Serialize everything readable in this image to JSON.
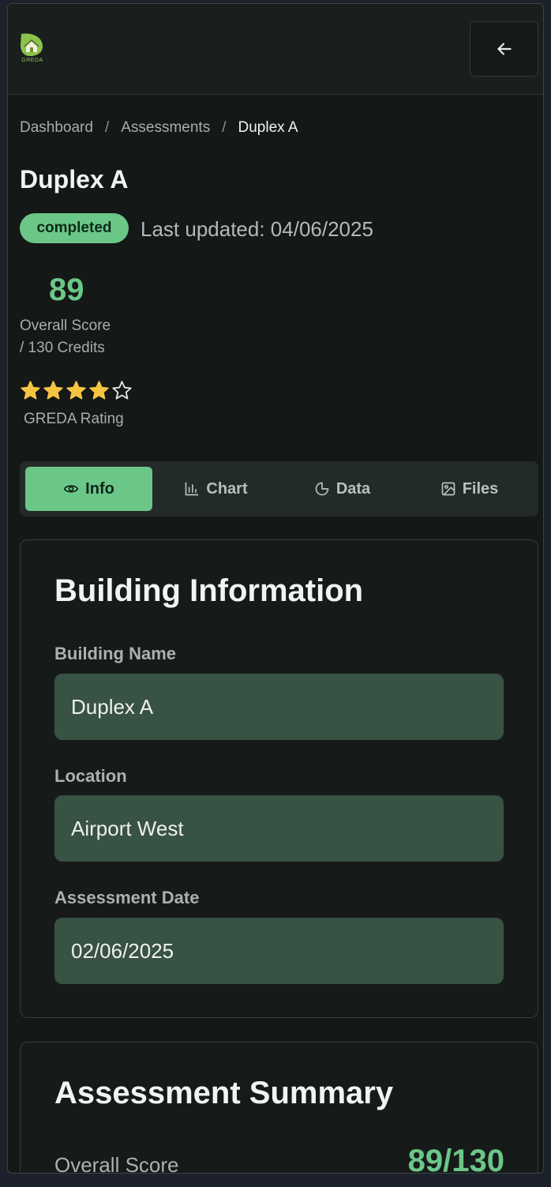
{
  "brand": {
    "logo_text": "GREDA"
  },
  "breadcrumb": [
    "Dashboard",
    "Assessments",
    "Duplex A"
  ],
  "breadcrumb_separator": "/",
  "page": {
    "title": "Duplex A",
    "status": "completed",
    "last_updated": "Last updated: 04/06/2025"
  },
  "score": {
    "value": "89",
    "label": "Overall Score",
    "credits": "/ 130 Credits"
  },
  "rating": {
    "stars_filled": 4,
    "stars_total": 5,
    "label": "GREDA Rating"
  },
  "tabs": [
    {
      "label": "Info",
      "icon": "eye-icon",
      "active": true
    },
    {
      "label": "Chart",
      "icon": "bar-chart-icon",
      "active": false
    },
    {
      "label": "Data",
      "icon": "pie-chart-icon",
      "active": false
    },
    {
      "label": "Files",
      "icon": "image-icon",
      "active": false
    }
  ],
  "building_info": {
    "heading": "Building Information",
    "fields": [
      {
        "label": "Building Name",
        "value": "Duplex A"
      },
      {
        "label": "Location",
        "value": "Airport West"
      },
      {
        "label": "Assessment Date",
        "value": "02/06/2025"
      }
    ]
  },
  "summary": {
    "heading": "Assessment Summary",
    "overall_label": "Overall Score",
    "overall_value": "89/130"
  },
  "colors": {
    "accent": "#6bc788",
    "background": "#141816",
    "field": "#385244",
    "star": "#f5c542"
  }
}
